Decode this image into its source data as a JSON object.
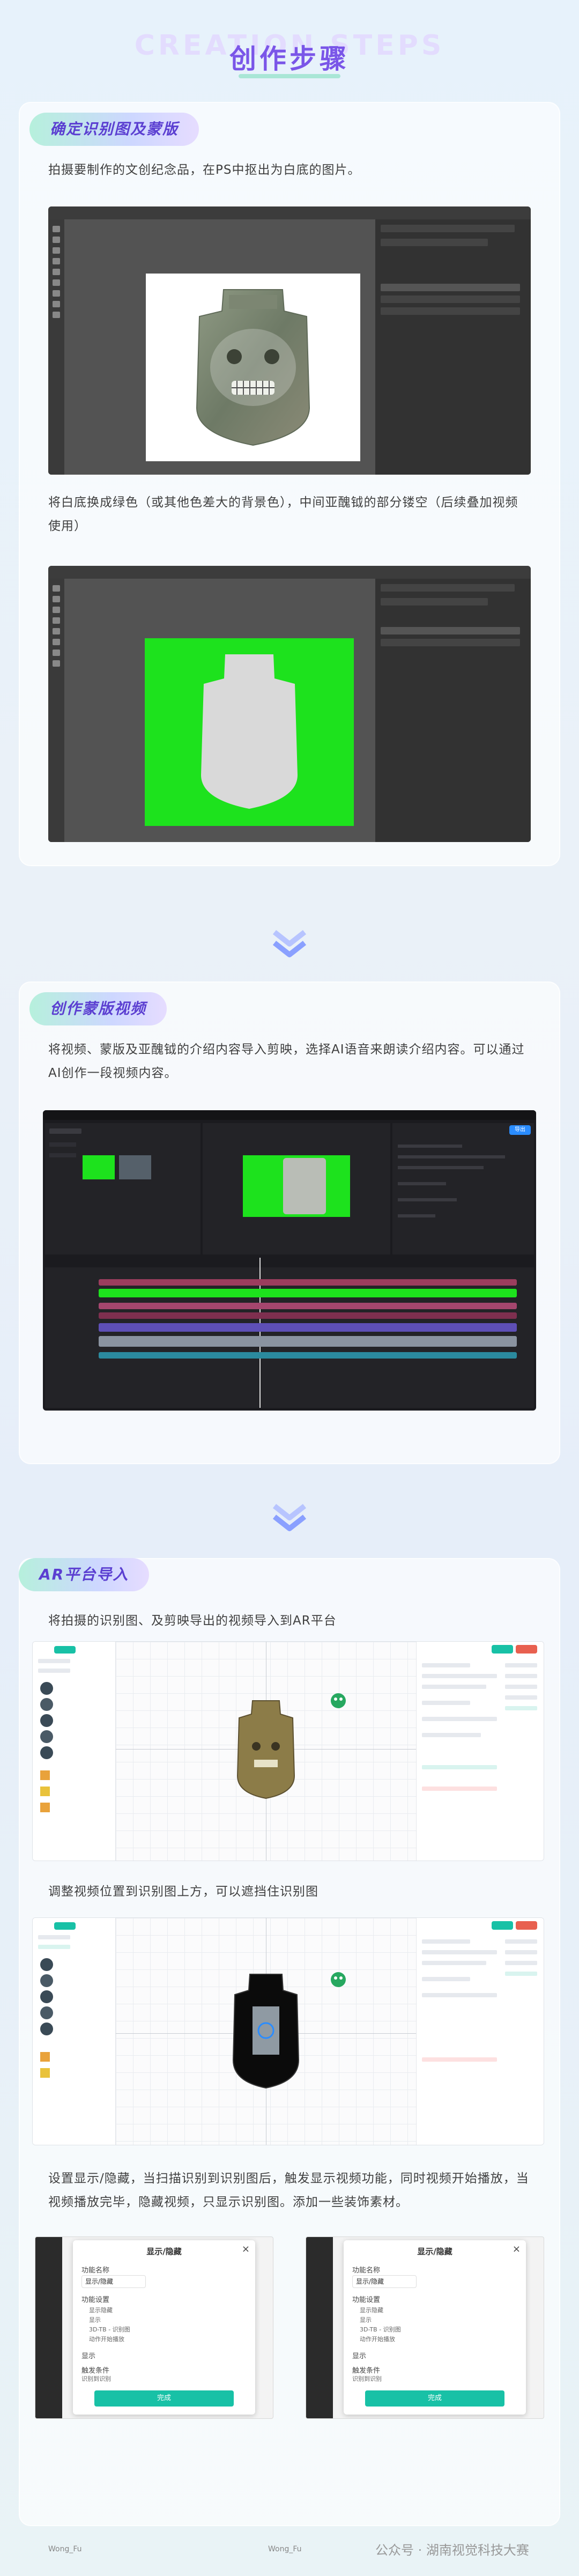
{
  "header": {
    "watermark": "CREATION STEPS",
    "title": "创作步骤"
  },
  "section1": {
    "tag": "确定识别图及蒙版",
    "desc1": "拍摄要制作的文创纪念品，在PS中抠出为白底的图片。",
    "desc2": "将白底换成绿色（或其他色差大的背景色），中间亚醜钺的部分镂空（后续叠加视频使用）"
  },
  "section2": {
    "tag": "创作蒙版视频",
    "desc": "将视频、蒙版及亚醜钺的介绍内容导入剪映，选择AI语音来朗读介绍内容。可以通过AI创作一段视频内容。",
    "capcut": {
      "export_label": "导出"
    }
  },
  "section3": {
    "tag": "AR平台导入",
    "desc1": "将拍摄的识别图、及剪映导出的视频导入到AR平台",
    "desc2": "调整视频位置到识别图上方，可以遮挡住识别图",
    "desc3": "设置显示/隐藏，当扫描识别到识别图后，触发显示视频功能，同时视频开始播放，当视频播放完毕，隐藏视频，只显示识别图。添加一些装饰素材。"
  },
  "dialog": {
    "title": "显示/隐藏",
    "close": "×",
    "field_name_label": "功能名称",
    "field_name_value": "显示/隐藏",
    "settings_label": "功能设置",
    "option_a": "显示隐藏",
    "option_b": "显示",
    "option_c": "3D-TB - 识别图",
    "option_d": "动作开始播放",
    "show_label": "显示",
    "trigger_label": "触发条件",
    "trigger_value": "识别到识别",
    "confirm": "完成"
  },
  "footer": {
    "left_user": "Wong_Fu",
    "mid_user": "Wong_Fu",
    "right_text": "公众号 · 湖南视觉科技大赛"
  },
  "colors": {
    "accent": "#7a56e8",
    "teal": "#18c1a6",
    "green_screen": "#1de21d"
  }
}
